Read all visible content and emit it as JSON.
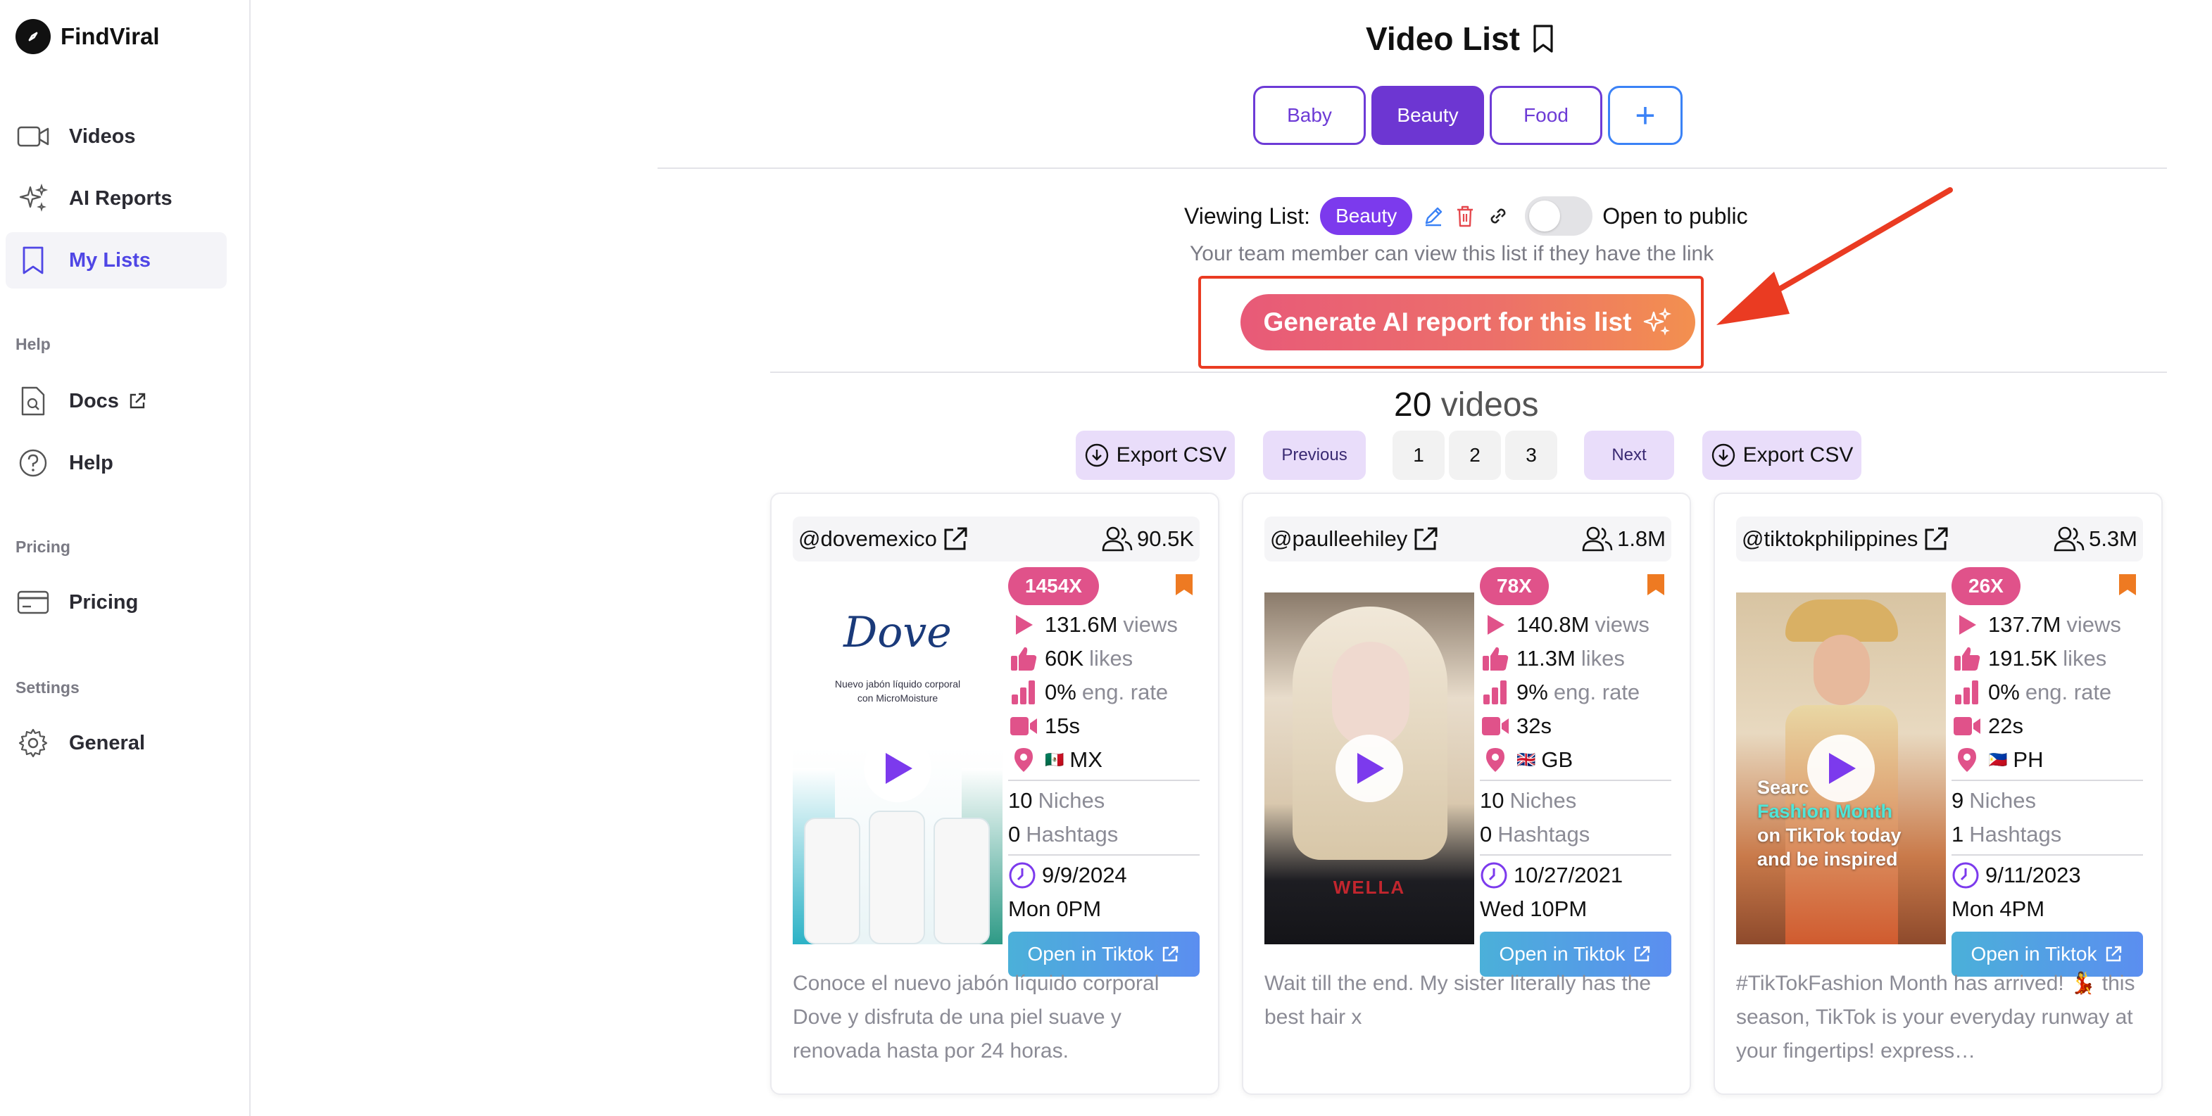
{
  "brand": {
    "name": "FindViral"
  },
  "sidebar": {
    "items": [
      {
        "label": "Videos",
        "icon": "video-camera-icon"
      },
      {
        "label": "AI Reports",
        "icon": "sparkles-icon"
      },
      {
        "label": "My Lists",
        "icon": "bookmark-icon",
        "active": true
      }
    ],
    "help_label": "Help",
    "help_items": [
      {
        "label": "Docs",
        "icon": "document-search-icon"
      },
      {
        "label": "Help",
        "icon": "question-circle-icon"
      }
    ],
    "pricing_label": "Pricing",
    "pricing_items": [
      {
        "label": "Pricing",
        "icon": "credit-card-icon"
      }
    ],
    "settings_label": "Settings",
    "settings_items": [
      {
        "label": "General",
        "icon": "gear-icon"
      }
    ]
  },
  "page": {
    "title": "Video List"
  },
  "tabs": [
    {
      "label": "Baby"
    },
    {
      "label": "Beauty",
      "active": true
    },
    {
      "label": "Food"
    }
  ],
  "viewing": {
    "label": "Viewing List:",
    "list_name": "Beauty",
    "public_label": "Open to public",
    "public_on": false,
    "note": "Your team member can view this list if they have the link"
  },
  "generate": {
    "label": "Generate AI report for this list"
  },
  "videos": {
    "count": "20",
    "word": "videos"
  },
  "pager": {
    "export_label": "Export CSV",
    "previous_label": "Previous",
    "next_label": "Next",
    "pages": [
      "1",
      "2",
      "3"
    ]
  },
  "cards": [
    {
      "handle": "@dovemexico",
      "followers": "90.5K",
      "multiplier": "1454X",
      "views": "131.6M",
      "likes": "60K",
      "eng_rate": "0%",
      "duration": "15s",
      "country_flag": "🇲🇽",
      "country": "MX",
      "niches": "10",
      "hashtags": "0",
      "date": "9/9/2024",
      "day": "Mon",
      "time": "0PM",
      "thumb_text": [
        "Dove",
        "Nuevo jabón líquido corporal",
        "con MicroMoisture"
      ],
      "description": "Conoce el nuevo jabón líquido corporal Dove y disfruta de una piel suave y renovada hasta por 24 horas."
    },
    {
      "handle": "@paulleehiley",
      "followers": "1.8M",
      "multiplier": "78X",
      "views": "140.8M",
      "likes": "11.3M",
      "eng_rate": "9%",
      "duration": "32s",
      "country_flag": "🇬🇧",
      "country": "GB",
      "niches": "10",
      "hashtags": "0",
      "date": "10/27/2021",
      "day": "Wed",
      "time": "10PM",
      "thumb_text": [
        "WELLA"
      ],
      "description": "Wait till the end. My sister literally has the best hair x"
    },
    {
      "handle": "@tiktokphilippines",
      "followers": "5.3M",
      "multiplier": "26X",
      "views": "137.7M",
      "likes": "191.5K",
      "eng_rate": "0%",
      "duration": "22s",
      "country_flag": "🇵🇭",
      "country": "PH",
      "niches": "9",
      "hashtags": "1",
      "date": "9/11/2023",
      "day": "Mon",
      "time": "4PM",
      "thumb_text": [
        "Searc",
        "Fashion Month",
        "on TikTok today",
        "and be inspired"
      ],
      "description": "#TikTokFashion Month has arrived! 💃 this season, TikTok is your everyday runway at your fingertips! express…"
    }
  ],
  "labels": {
    "views": "views",
    "likes": "likes",
    "eng_rate": "eng. rate",
    "niches": "Niches",
    "hashtags": "Hashtags",
    "open_btn": "Open in Tiktok"
  },
  "colors": {
    "accent": "#6d36d2",
    "link_blue": "#3b82f6",
    "stat_pink": "#e0528a",
    "bookmark_orange": "#ee7a22",
    "annotation_red": "#ea3b22"
  }
}
